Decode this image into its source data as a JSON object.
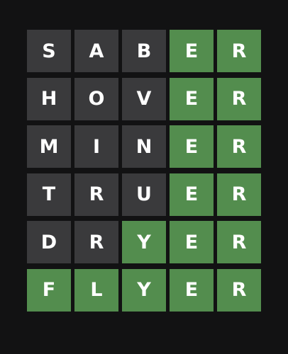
{
  "board": {
    "rows": [
      {
        "tiles": [
          {
            "letter": "S",
            "state": "absent"
          },
          {
            "letter": "A",
            "state": "absent"
          },
          {
            "letter": "B",
            "state": "absent"
          },
          {
            "letter": "E",
            "state": "correct"
          },
          {
            "letter": "R",
            "state": "correct"
          }
        ]
      },
      {
        "tiles": [
          {
            "letter": "H",
            "state": "absent"
          },
          {
            "letter": "O",
            "state": "absent"
          },
          {
            "letter": "V",
            "state": "absent"
          },
          {
            "letter": "E",
            "state": "correct"
          },
          {
            "letter": "R",
            "state": "correct"
          }
        ]
      },
      {
        "tiles": [
          {
            "letter": "M",
            "state": "absent"
          },
          {
            "letter": "I",
            "state": "absent"
          },
          {
            "letter": "N",
            "state": "absent"
          },
          {
            "letter": "E",
            "state": "correct"
          },
          {
            "letter": "R",
            "state": "correct"
          }
        ]
      },
      {
        "tiles": [
          {
            "letter": "T",
            "state": "absent"
          },
          {
            "letter": "R",
            "state": "absent"
          },
          {
            "letter": "U",
            "state": "absent"
          },
          {
            "letter": "E",
            "state": "correct"
          },
          {
            "letter": "R",
            "state": "correct"
          }
        ]
      },
      {
        "tiles": [
          {
            "letter": "D",
            "state": "absent"
          },
          {
            "letter": "R",
            "state": "absent"
          },
          {
            "letter": "Y",
            "state": "correct"
          },
          {
            "letter": "E",
            "state": "correct"
          },
          {
            "letter": "R",
            "state": "correct"
          }
        ]
      },
      {
        "tiles": [
          {
            "letter": "F",
            "state": "correct"
          },
          {
            "letter": "L",
            "state": "correct"
          },
          {
            "letter": "Y",
            "state": "correct"
          },
          {
            "letter": "E",
            "state": "correct"
          },
          {
            "letter": "R",
            "state": "correct"
          }
        ]
      }
    ]
  },
  "colors": {
    "background": "#121213",
    "absent": "#3a3a3c",
    "correct": "#538d4e",
    "text": "#ffffff"
  }
}
